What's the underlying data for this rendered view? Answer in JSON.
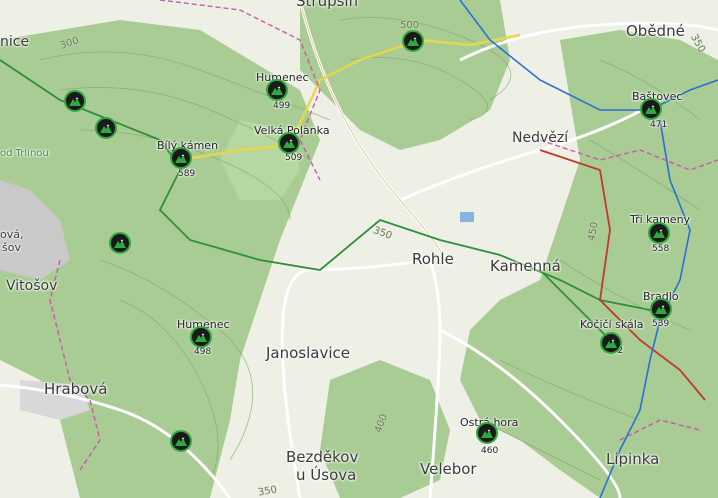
{
  "towns": {
    "obedne": "Obědné",
    "nedvezi": "Nedvězí",
    "rohle": "Rohle",
    "kamenna": "Kamenná",
    "janoslavice": "Janoslavice",
    "hrabova": "Hrabová",
    "bezdekov_line1": "Bezděkov",
    "bezdekov_line2": "u Úsova",
    "velebor": "Velebor",
    "lipinka": "Lipinka",
    "strupsin": "Strupšín",
    "vitosov": "Vitošov",
    "vitosov_partial_1": "ová,",
    "vitosov_partial_2": "šov",
    "nice_partial": "nice"
  },
  "hills": [
    {
      "name": "Humenec",
      "elev": "499"
    },
    {
      "name": "Velká Polanka",
      "elev": "509"
    },
    {
      "name": "Bílý kámen",
      "elev": "589"
    },
    {
      "name": "Humenec",
      "elev": "498"
    },
    {
      "name": "Baštovec",
      "elev": "471"
    },
    {
      "name": "Tři kameny",
      "elev": "558"
    },
    {
      "name": "Bradlo",
      "elev": "539"
    },
    {
      "name": "Kočičí skála",
      "elev": "532"
    },
    {
      "name": "Ostrá hora",
      "elev": "460"
    }
  ],
  "contour_labels": [
    "300",
    "500",
    "350",
    "450",
    "400",
    "350",
    "350"
  ],
  "trail_label": "od Trlinou",
  "colors": {
    "forest": "#9cc48a",
    "meadow": "#eef0e6",
    "trail_green": "#2f8f3a",
    "trail_yellow": "#e6d84a",
    "trail_red": "#c0392b",
    "trail_blue": "#2a6fd6",
    "border": "#c85aa8",
    "peak_icon": "#2fa83f"
  }
}
